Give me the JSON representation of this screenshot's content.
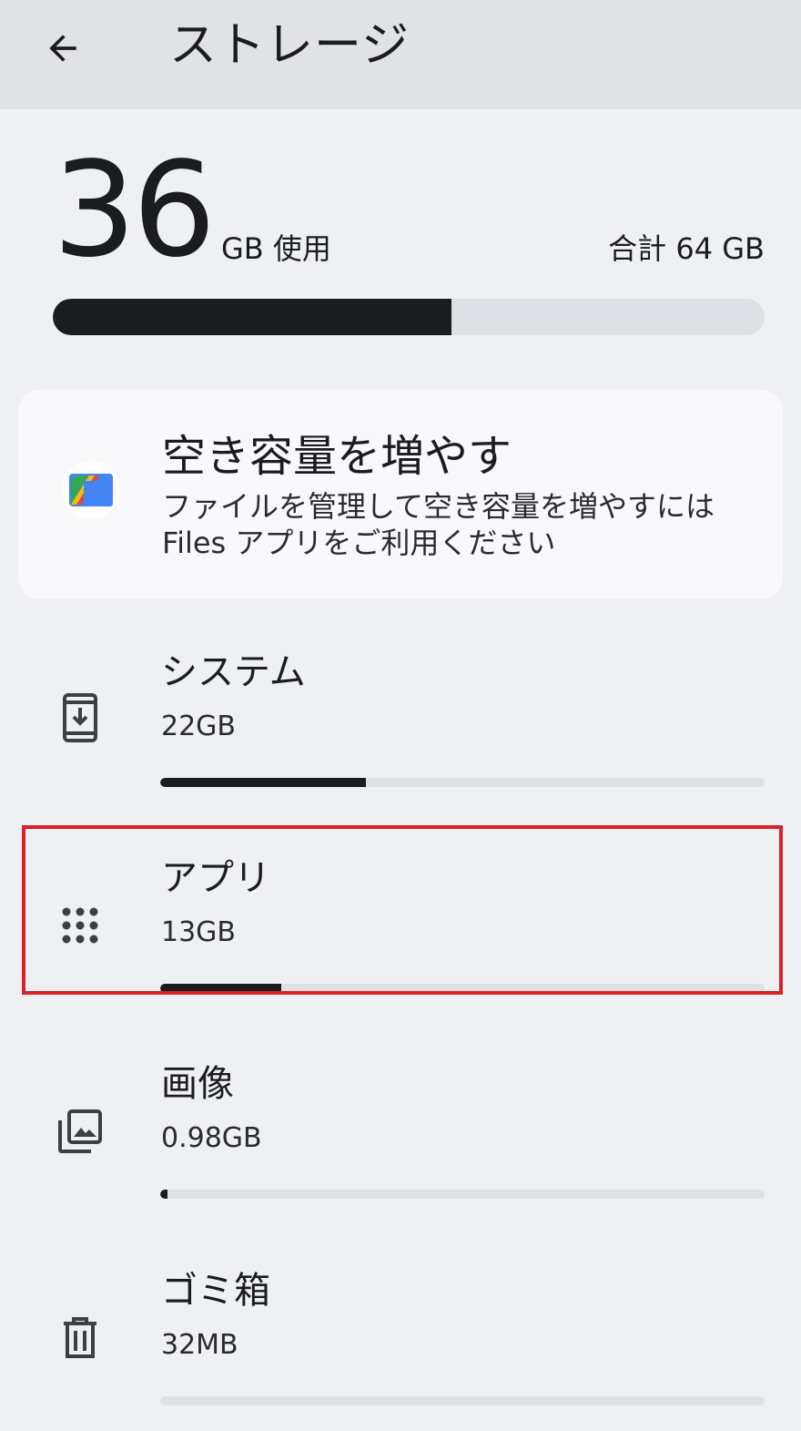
{
  "header": {
    "back_icon": "arrow-left-icon",
    "title": "ストレージ"
  },
  "summary": {
    "used_value": "36",
    "used_unit": "GB 使用",
    "total": "合計 64 GB",
    "used_fraction": 0.56
  },
  "free_up_card": {
    "icon": "files-app-icon",
    "title": "空き容量を増やす",
    "description": "ファイルを管理して空き容量を増やすには Files アプリをご利用ください"
  },
  "items": [
    {
      "label": "システム",
      "size": "22GB",
      "icon": "system-update-icon",
      "fraction": 0.34
    },
    {
      "label": "アプリ",
      "size": "13GB",
      "icon": "apps-grid-icon",
      "fraction": 0.2,
      "highlighted": true
    },
    {
      "label": "画像",
      "size": "0.98GB",
      "icon": "photo-library-icon",
      "fraction": 0.012
    },
    {
      "label": "ゴミ箱",
      "size": "32MB",
      "icon": "trash-icon",
      "fraction": 0.0
    }
  ],
  "colors": {
    "background": "#eff0f2",
    "appbar": "#e1e2e4",
    "bar_fill": "#1a1c1e",
    "bar_track": "#dde1e6",
    "highlight_border": "#dc2028"
  }
}
